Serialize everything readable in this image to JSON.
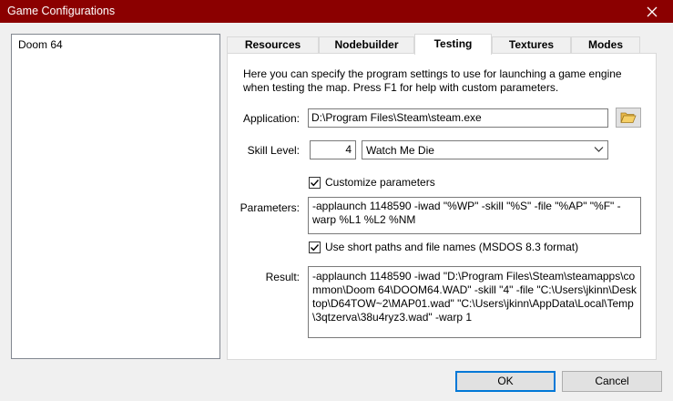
{
  "window": {
    "title": "Game Configurations",
    "close_icon": "close-icon"
  },
  "configurations": [
    {
      "name": "Doom 64"
    }
  ],
  "tabs": [
    {
      "label": "Resources",
      "active": false
    },
    {
      "label": "Nodebuilder",
      "active": false
    },
    {
      "label": "Testing",
      "active": true
    },
    {
      "label": "Textures",
      "active": false
    },
    {
      "label": "Modes",
      "active": false
    }
  ],
  "testing": {
    "description": "Here you can specify the program settings to use for launching a game engine when testing the map. Press F1 for help with custom parameters.",
    "application_label": "Application:",
    "application_value": "D:\\Program Files\\Steam\\steam.exe",
    "browse_icon": "folder-open-icon",
    "skill_label": "Skill Level:",
    "skill_number": "4",
    "skill_name": "Watch Me Die",
    "customize_label": "Customize parameters",
    "customize_checked": true,
    "parameters_label": "Parameters:",
    "parameters_value": "-applaunch 1148590 -iwad \"%WP\" -skill \"%S\" -file \"%AP\" \"%F\" -warp %L1 %L2 %NM",
    "shortpaths_label": "Use short paths and file names (MSDOS 8.3 format)",
    "shortpaths_checked": true,
    "result_label": "Result:",
    "result_value": "-applaunch 1148590 -iwad \"D:\\Program Files\\Steam\\steamapps\\common\\Doom 64\\DOOM64.WAD\" -skill \"4\" -file \"C:\\Users\\jkinn\\Desktop\\D64TOW~2\\MAP01.wad\" \"C:\\Users\\jkinn\\AppData\\Local\\Temp\\3qtzerva\\38u4ryz3.wad\" -warp 1"
  },
  "buttons": {
    "ok": "OK",
    "cancel": "Cancel"
  },
  "colors": {
    "titlebar": "#8b0000",
    "default_button_border": "#0078d7"
  }
}
